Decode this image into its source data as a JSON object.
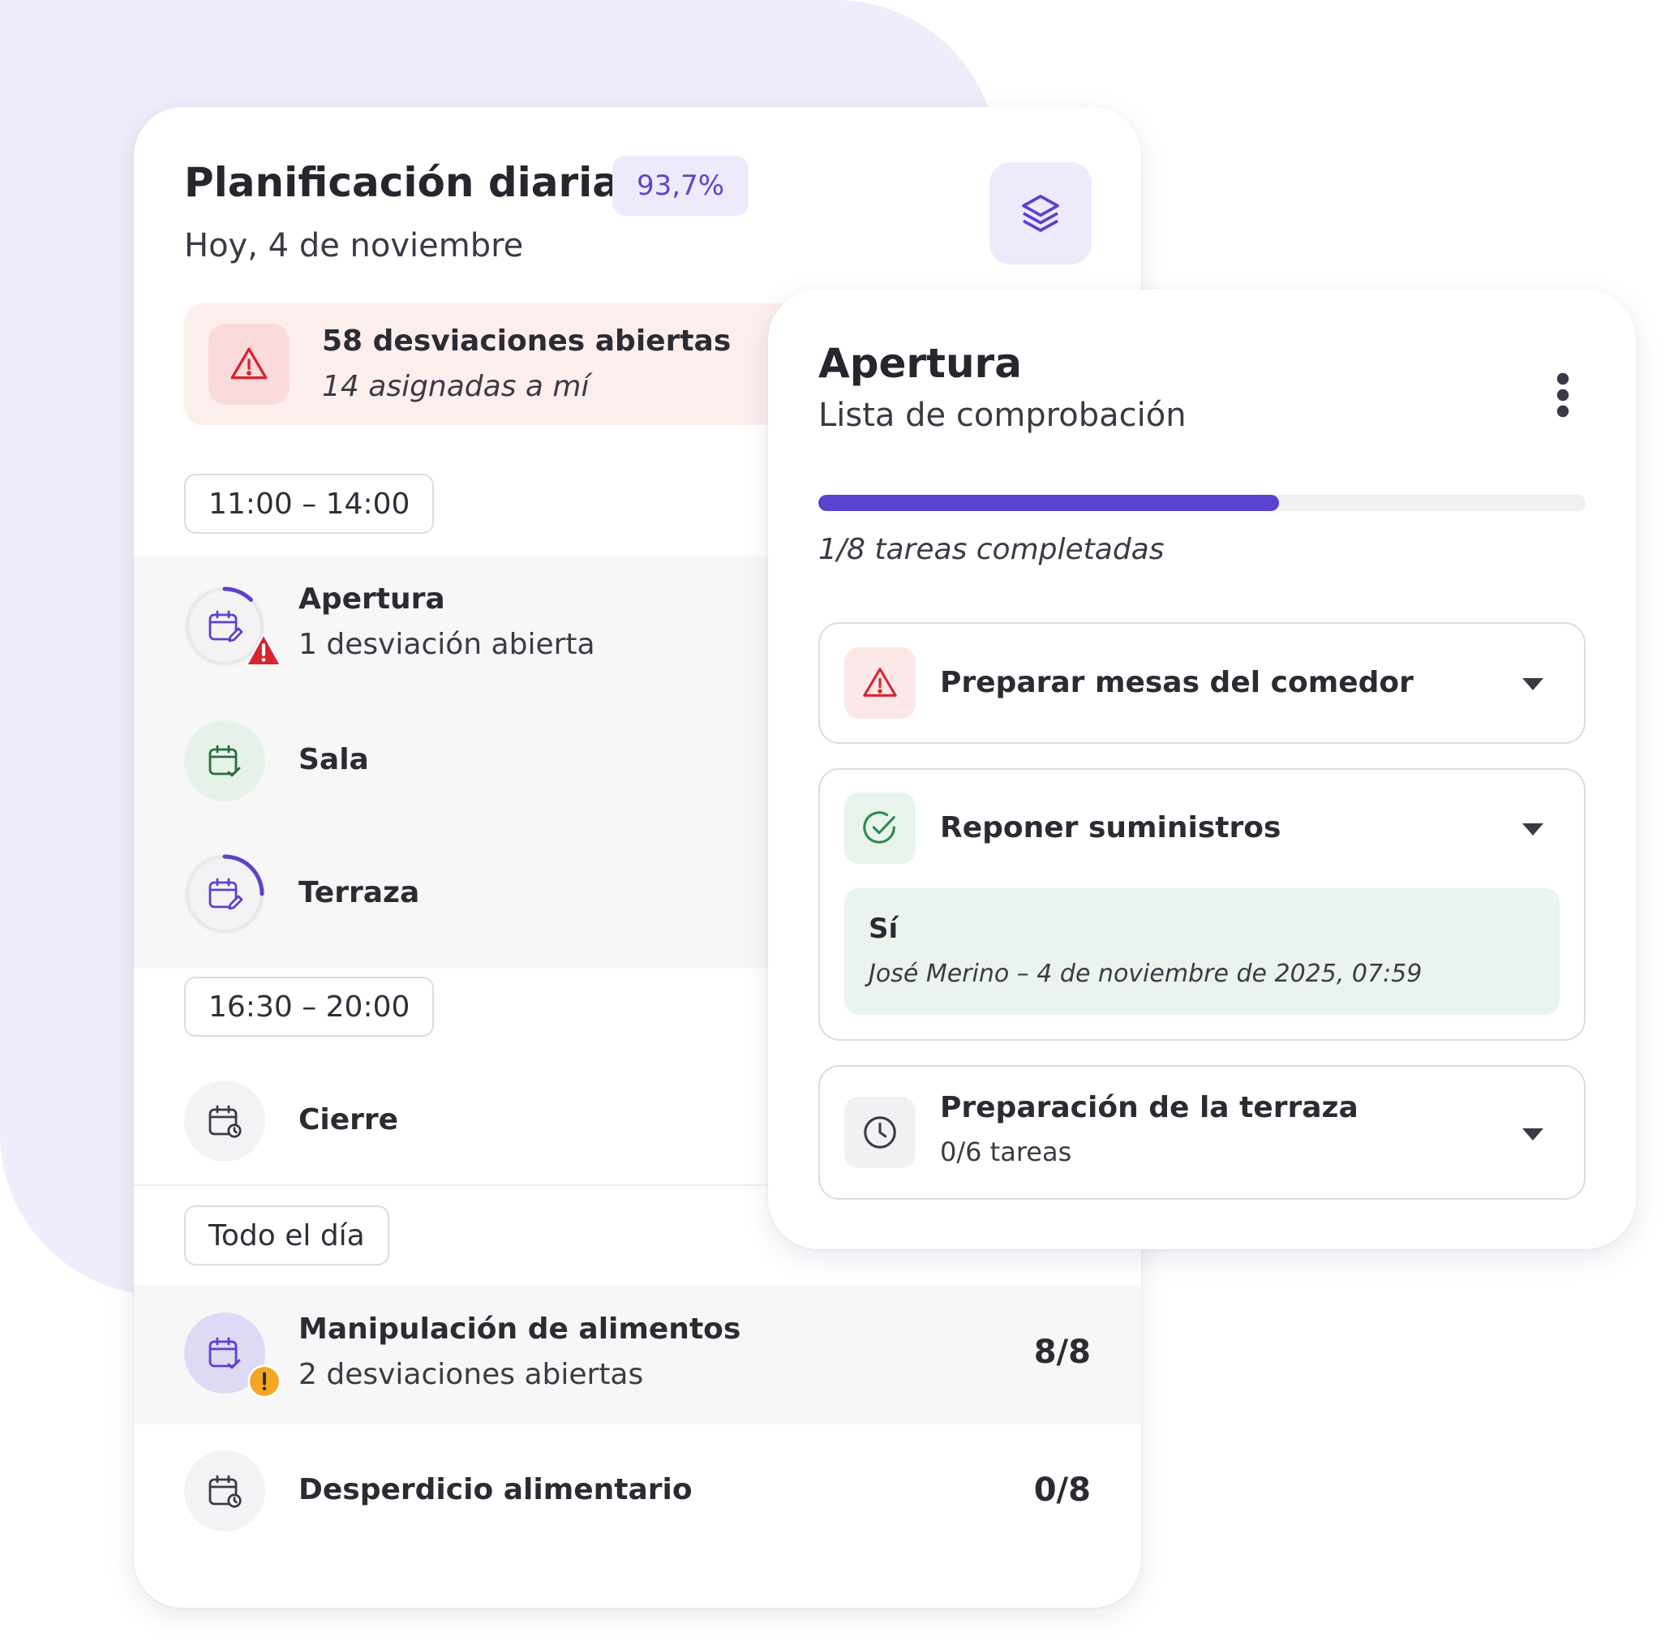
{
  "planning": {
    "title": "Planificación diaria",
    "completion": "93,7%",
    "date": "Hoy, 4 de noviembre",
    "layers_icon": "layers-icon"
  },
  "alert": {
    "title": "58 desviaciones abiertas",
    "subtitle": "14 asignadas a mí",
    "icon": "warning-triangle-icon"
  },
  "slots": [
    {
      "time": "11:00 – 14:00",
      "items": [
        {
          "label": "Apertura",
          "sub": "1 desviación abierta",
          "icon": "calendar-edit-icon",
          "badge": "red-warning-icon",
          "progress": 0.125
        },
        {
          "label": "Sala",
          "icon": "calendar-check-icon",
          "status": "completed"
        },
        {
          "label": "Terraza",
          "icon": "calendar-edit-icon",
          "progress": 0.25
        }
      ]
    },
    {
      "time": "16:30 – 20:00",
      "items": [
        {
          "label": "Cierre",
          "icon": "calendar-clock-icon",
          "status": "scheduled"
        }
      ]
    },
    {
      "time": "Todo el día",
      "items": [
        {
          "label": "Manipulación de alimentos",
          "sub": "2 desviaciones abiertas",
          "count": "8/8",
          "icon": "calendar-check-icon",
          "badge": "orange-exclamation-icon"
        },
        {
          "label": "Desperdicio alimentario",
          "count": "0/8",
          "icon": "calendar-clock-icon"
        }
      ]
    }
  ],
  "detail": {
    "title": "Apertura",
    "subtitle": "Lista de comprobación",
    "progress": 0.6,
    "progress_text": "1/8 tareas completadas",
    "tasks": [
      {
        "label": "Preparar mesas del comedor",
        "icon": "warning-triangle-icon"
      },
      {
        "label": "Reponer suministros",
        "icon": "check-circle-icon",
        "answer": "Sí",
        "answer_meta": "José Merino – 4 de noviembre de 2025, 07:59"
      },
      {
        "label": "Preparación de la terraza",
        "sub": "0/6 tareas",
        "icon": "clock-icon"
      }
    ]
  },
  "colors": {
    "accent": "#5b41cf",
    "danger": "#d9242c",
    "success": "#2f8a4a",
    "warning": "#f5a623",
    "background_blob": "#efecfb"
  }
}
